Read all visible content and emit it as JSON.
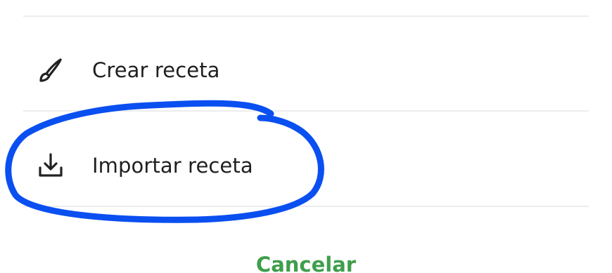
{
  "menu": {
    "items": [
      {
        "label": "Crear receta",
        "icon": "brush-icon"
      },
      {
        "label": "Importar receta",
        "icon": "download-icon"
      }
    ]
  },
  "actions": {
    "cancel_label": "Cancelar"
  },
  "colors": {
    "cancel_text": "#3f9e4c",
    "annotation_stroke": "#0a4ff0",
    "divider": "#ececec",
    "text": "#1f1f1f"
  },
  "annotation": {
    "shape": "hand-drawn-circle",
    "highlights": "Importar receta"
  }
}
